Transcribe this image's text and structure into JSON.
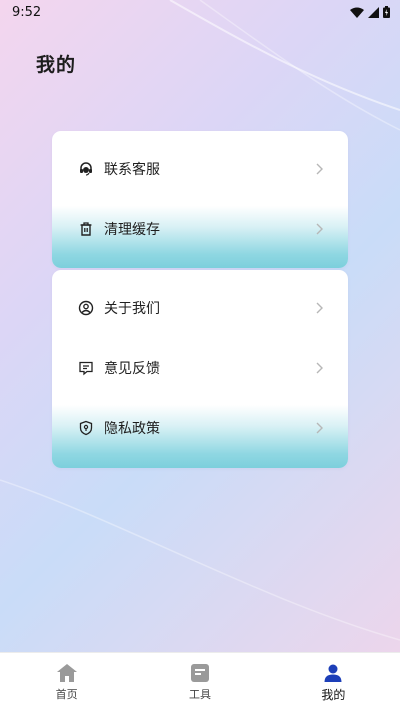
{
  "status_bar": {
    "time": "9:52"
  },
  "page": {
    "title": "我的"
  },
  "menu_groups": [
    {
      "items": [
        {
          "label": "联系客服",
          "icon": "headset-icon"
        },
        {
          "label": "清理缓存",
          "icon": "trash-icon"
        }
      ]
    },
    {
      "items": [
        {
          "label": "关于我们",
          "icon": "user-circle-icon"
        },
        {
          "label": "意见反馈",
          "icon": "feedback-icon"
        },
        {
          "label": "隐私政策",
          "icon": "shield-icon"
        }
      ]
    }
  ],
  "tabbar": {
    "tabs": [
      {
        "label": "首页",
        "icon": "home-icon"
      },
      {
        "label": "工具",
        "icon": "document-icon"
      },
      {
        "label": "我的",
        "icon": "person-icon",
        "active": true
      }
    ]
  },
  "colors": {
    "accent": "#1d3fb8",
    "highlight": "#7ccfdc",
    "inactive_icon": "#9a9a9a"
  }
}
